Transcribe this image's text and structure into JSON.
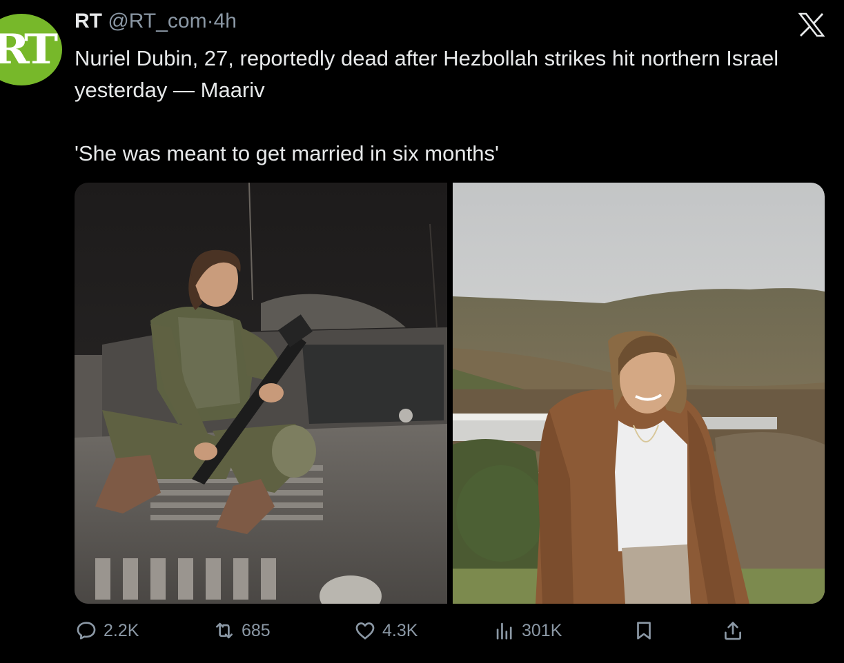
{
  "author": {
    "avatar_text": "RT",
    "name": "RT",
    "handle": "@RT_com",
    "separator": "·",
    "time": "4h"
  },
  "tweet": {
    "line1": "Nuriel Dubin, 27, reportedly dead after Hezbollah strikes hit northern Israel yesterday — Maariv",
    "line2": "'She was meant to get married in six months'"
  },
  "actions": {
    "replies": "2.2K",
    "reposts": "685",
    "likes": "4.3K",
    "views": "301K"
  },
  "icons": {
    "close": "x-logo-icon",
    "reply": "reply-icon",
    "repost": "repost-icon",
    "like": "heart-icon",
    "views": "views-icon",
    "bookmark": "bookmark-icon",
    "share": "share-icon"
  },
  "colors": {
    "background": "#000000",
    "text_primary": "#e7e9ea",
    "text_secondary": "#8b98a5",
    "avatar": "#77b82a"
  }
}
